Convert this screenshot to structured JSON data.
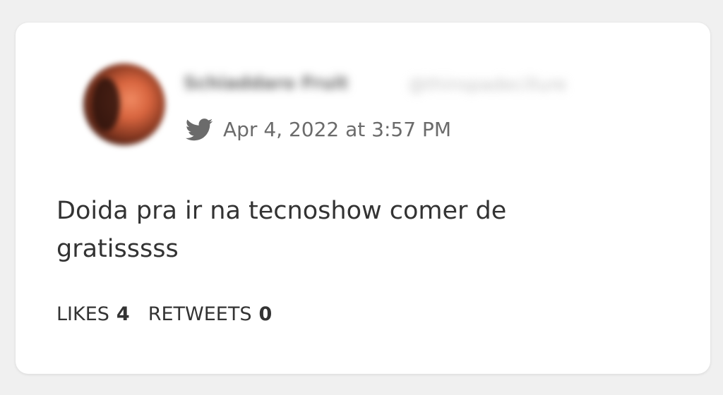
{
  "tweet": {
    "user": {
      "display_name": "Schiaddaro Fruit",
      "handle": "@thinspadecillure"
    },
    "timestamp": "Apr 4, 2022 at 3:57 PM",
    "text": "Doida pra ir na tecnoshow comer de\ngratisssss",
    "stats": {
      "likes_label": "LIKES",
      "likes_count": "4",
      "retweets_label": "RETWEETS",
      "retweets_count": "0"
    },
    "icons": {
      "source": "twitter-bird-icon",
      "avatar": "avatar"
    },
    "colors": {
      "page_background": "#f0f0f0",
      "card_background": "#ffffff",
      "meta_text": "#6b6b6b",
      "body_text": "#333333"
    }
  }
}
